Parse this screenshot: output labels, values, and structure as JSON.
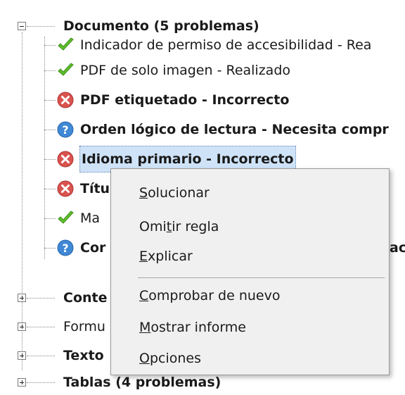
{
  "tree": {
    "document": {
      "label": "Documento (5 problemas)",
      "expanded": true
    },
    "children": [
      {
        "status": "pass",
        "label": "Indicador de permiso de accesibilidad - Rea",
        "bold": false
      },
      {
        "status": "pass",
        "label": "PDF de solo imagen - Realizado",
        "bold": false
      },
      {
        "status": "fail",
        "label": "PDF etiquetado - Incorrecto",
        "bold": true
      },
      {
        "status": "check",
        "label": "Orden lógico de lectura - Necesita compr",
        "bold": true
      },
      {
        "status": "fail",
        "label": "Idioma primario - Incorrecto",
        "bold": true,
        "selected": true
      },
      {
        "status": "fail",
        "label": "Títu",
        "bold": true
      },
      {
        "status": "pass",
        "label": "Ma",
        "bold": false
      },
      {
        "status": "check",
        "label": "Cor",
        "bold": true,
        "tail": "ac"
      }
    ],
    "sections": [
      {
        "label": "Conte",
        "bold": true
      },
      {
        "label": "Formu",
        "bold": false
      },
      {
        "label": "Texto",
        "bold": true
      },
      {
        "label": "Tablas (4 problemas)",
        "bold": true
      }
    ]
  },
  "context_menu": {
    "items": [
      {
        "pre": "",
        "u": "S",
        "post": "olucionar"
      },
      {
        "pre": "Omi",
        "u": "t",
        "post": "ir regla"
      },
      {
        "pre": "",
        "u": "E",
        "post": "xplicar"
      },
      {
        "pre": "",
        "u": "C",
        "post": "omprobar de nuevo"
      },
      {
        "pre": "",
        "u": "M",
        "post": "ostrar informe"
      },
      {
        "pre": "",
        "u": "O",
        "post": "pciones"
      }
    ]
  },
  "icons": {
    "pass": "check-icon",
    "fail": "error-icon",
    "check": "help-icon"
  },
  "colors": {
    "pass": "#5fbf2c",
    "fail": "#d9534f",
    "check": "#3f88d6",
    "selection": "#cfe3f8"
  }
}
